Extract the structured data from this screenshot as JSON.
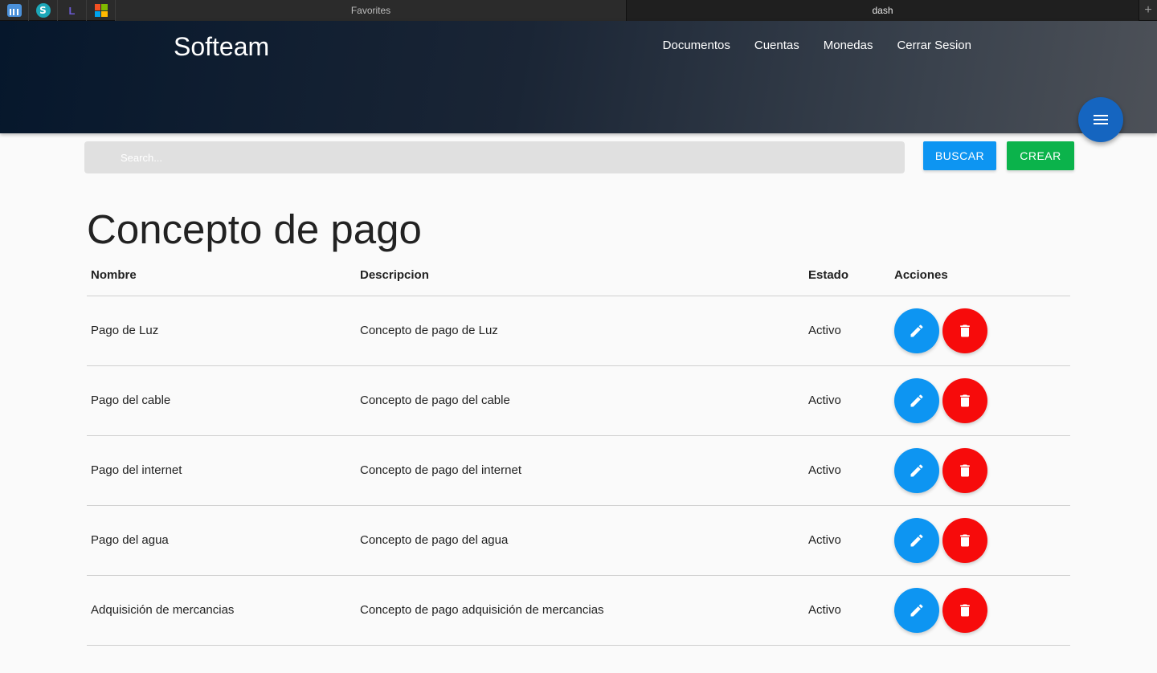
{
  "browser": {
    "bookmarks": [
      "bank-icon",
      "s-icon",
      "l-icon",
      "windows-icon"
    ],
    "l_letter": "L",
    "s_letter": "S",
    "tabs": [
      {
        "label": "Favorites"
      },
      {
        "label": "dash"
      }
    ],
    "new_tab_label": "+"
  },
  "header": {
    "brand": "Softeam",
    "nav": [
      {
        "label": "Documentos"
      },
      {
        "label": "Cuentas"
      },
      {
        "label": "Monedas"
      },
      {
        "label": "Cerrar Sesion"
      }
    ],
    "fab_icon": "menu-icon",
    "gradient_colors": [
      "#06172c",
      "#4d5158"
    ]
  },
  "search": {
    "placeholder": "Search...",
    "value": "",
    "buscar_label": "BUSCAR",
    "crear_label": "CREAR",
    "buscar_color": "#0d95f2",
    "crear_color": "#0bb34b"
  },
  "page": {
    "title": "Concepto de pago"
  },
  "table": {
    "columns": [
      "Nombre",
      "Descripcion",
      "Estado",
      "Acciones"
    ],
    "rows": [
      {
        "nombre": "Pago de Luz",
        "descripcion": "Concepto de pago de Luz",
        "estado": "Activo"
      },
      {
        "nombre": "Pago del cable",
        "descripcion": "Concepto de pago del cable",
        "estado": "Activo"
      },
      {
        "nombre": "Pago del internet",
        "descripcion": "Concepto de pago del internet",
        "estado": "Activo"
      },
      {
        "nombre": "Pago del agua",
        "descripcion": "Concepto de pago del agua",
        "estado": "Activo"
      },
      {
        "nombre": "Adquisición de mercancias",
        "descripcion": "Concepto de pago adquisición de mercancias",
        "estado": "Activo"
      }
    ],
    "action_icons": [
      "pencil-icon",
      "trash-icon"
    ],
    "edit_color": "#0d95f2",
    "delete_color": "#f70b0b"
  }
}
